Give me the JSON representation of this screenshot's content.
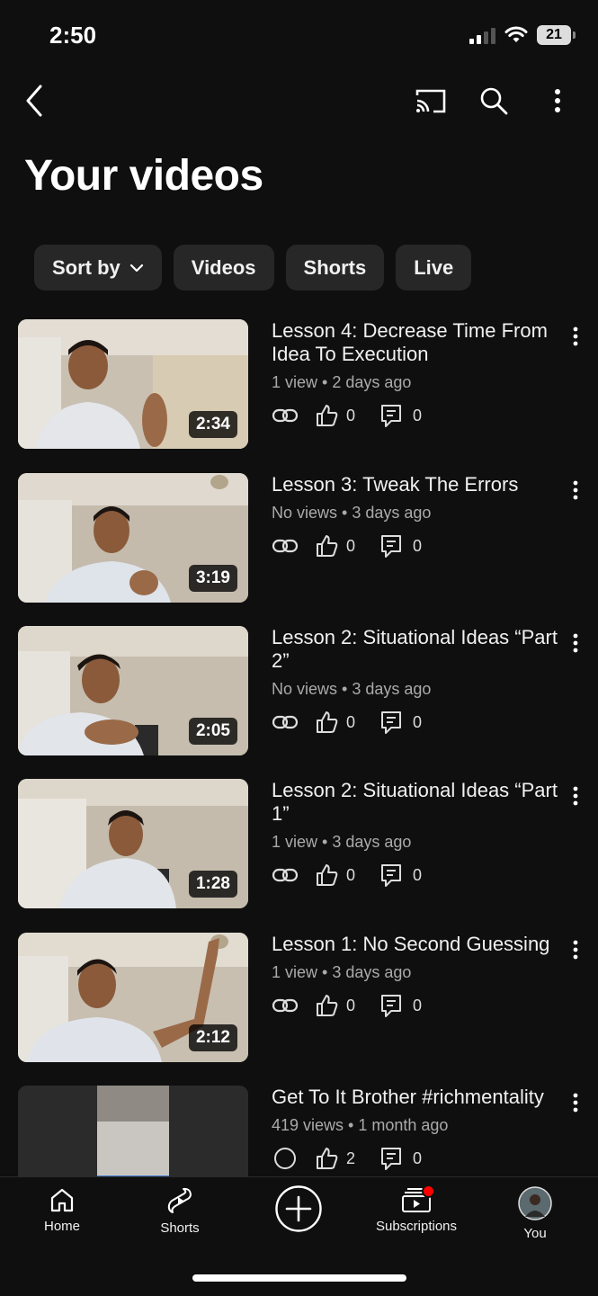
{
  "status": {
    "time": "2:50",
    "battery": "21"
  },
  "header": {
    "title": "Your videos"
  },
  "chips": [
    {
      "label": "Sort by"
    },
    {
      "label": "Videos"
    },
    {
      "label": "Shorts"
    },
    {
      "label": "Live"
    }
  ],
  "videos": [
    {
      "title": "Lesson 4: Decrease Time From Idea To Execution",
      "meta": "1 view • 2 days ago",
      "likes": "0",
      "comments": "0",
      "duration": "2:34"
    },
    {
      "title": "Lesson 3: Tweak The Errors",
      "meta": "No views • 3 days ago",
      "likes": "0",
      "comments": "0",
      "duration": "3:19"
    },
    {
      "title": "Lesson 2: Situational Ideas “Part 2”",
      "meta": "No views • 3 days ago",
      "likes": "0",
      "comments": "0",
      "duration": "2:05"
    },
    {
      "title": "Lesson 2: Situational Ideas “Part 1”",
      "meta": "1 view • 3 days ago",
      "likes": "0",
      "comments": "0",
      "duration": "1:28"
    },
    {
      "title": "Lesson 1: No Second Guessing",
      "meta": "1 view • 3 days ago",
      "likes": "0",
      "comments": "0",
      "duration": "2:12"
    },
    {
      "title": "Get To It Brother #richmentality",
      "meta": "419 views • 1 month ago",
      "likes": "2",
      "comments": "0",
      "duration": ""
    }
  ],
  "nav": {
    "home": "Home",
    "shorts": "Shorts",
    "subscriptions": "Subscriptions",
    "you": "You"
  },
  "colors": {
    "background": "#0f0f0f",
    "chip": "#272727",
    "notification": "#ff0000"
  }
}
